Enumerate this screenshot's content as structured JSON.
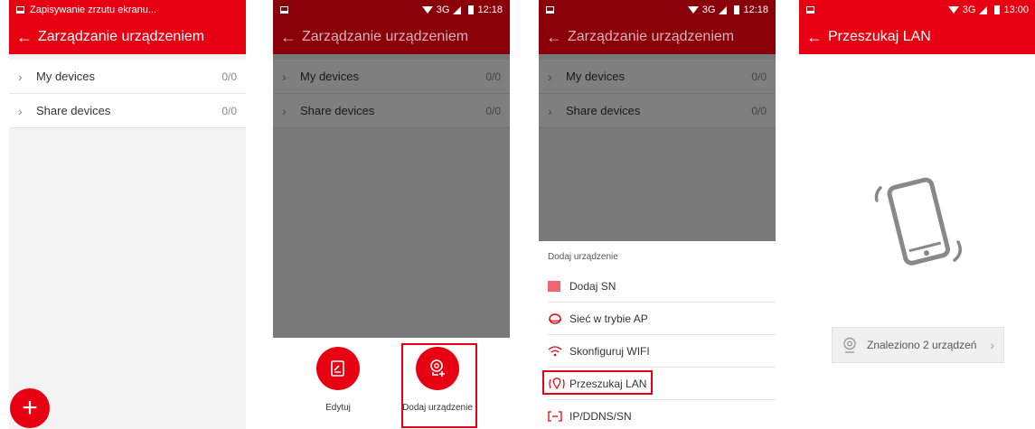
{
  "colors": {
    "accent": "#e60012",
    "accent_dark": "#8a0009"
  },
  "screen1": {
    "status_text": "Zapisywanie zrzutu ekranu...",
    "title": "Zarządzanie urządzeniem",
    "rows": [
      {
        "label": "My devices",
        "count": "0/0"
      },
      {
        "label": "Share devices",
        "count": "0/0"
      }
    ],
    "fab_label": "+"
  },
  "screen2": {
    "status_network": "3G",
    "status_time": "12:18",
    "title": "Zarządzanie urządzeniem",
    "rows": [
      {
        "label": "My devices",
        "count": "0/0"
      },
      {
        "label": "Share devices",
        "count": "0/0"
      }
    ],
    "actions": [
      {
        "label": "Edytuj",
        "icon": "edit-icon"
      },
      {
        "label": "Dodaj urządzenie",
        "icon": "add-camera-icon"
      }
    ]
  },
  "screen3": {
    "status_network": "3G",
    "status_time": "12:18",
    "title": "Zarządzanie urządzeniem",
    "rows": [
      {
        "label": "My devices",
        "count": "0/0"
      },
      {
        "label": "Share devices",
        "count": "0/0"
      }
    ],
    "menu_title": "Dodaj urządzenie",
    "menu_items": [
      {
        "label": "Dodaj SN",
        "icon": "barcode-icon"
      },
      {
        "label": "Sieć w trybie AP",
        "icon": "ap-mode-icon"
      },
      {
        "label": "Skonfiguruj WIFI",
        "icon": "wifi-icon"
      },
      {
        "label": "Przeszukaj LAN",
        "icon": "lan-search-icon"
      },
      {
        "label": "IP/DDNS/SN",
        "icon": "ip-icon"
      }
    ]
  },
  "screen4": {
    "status_network": "3G",
    "status_time": "13:00",
    "title": "Przeszukaj LAN",
    "found_label": "Znaleziono 2 urządzeń"
  },
  "glyphs": {
    "back": "←",
    "chevron": "›"
  }
}
